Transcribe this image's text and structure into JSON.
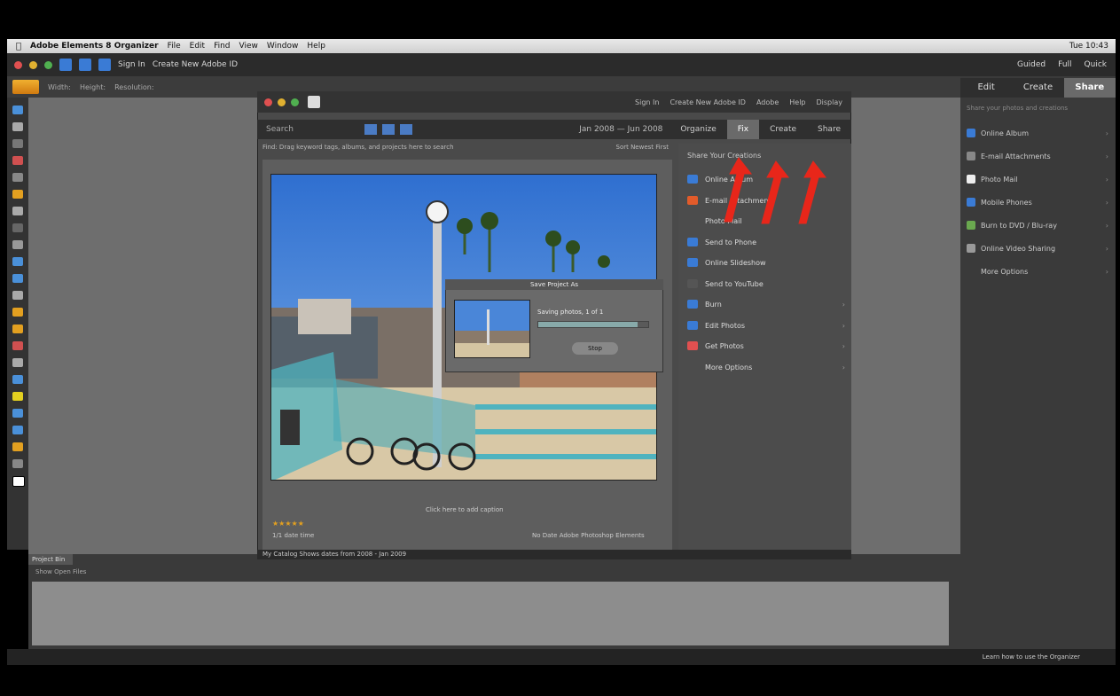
{
  "menubar": {
    "apple": "",
    "app": "Adobe Elements 8 Organizer",
    "items": [
      "File",
      "Edit",
      "Find",
      "View",
      "Window",
      "Help"
    ],
    "clock": "Tue 10:43"
  },
  "editor_bar": {
    "signin": "Sign In",
    "create_id": "Create New Adobe ID",
    "right": [
      "Guided",
      "Full",
      "Quick"
    ]
  },
  "optbar": {
    "items": [
      "Width:",
      "Height:",
      "Resolution:"
    ]
  },
  "right_panel": {
    "tabs": [
      "Edit",
      "Create",
      "Share"
    ],
    "subtitle": "Share your photos and creations",
    "items": [
      {
        "label": "Online Album",
        "color": "#3a7bd5"
      },
      {
        "label": "E-mail Attachments",
        "color": "#888"
      },
      {
        "label": "Photo Mail",
        "color": "#eee"
      },
      {
        "label": "Mobile Phones",
        "color": "#3a7bd5"
      },
      {
        "label": "Burn to DVD / Blu-ray",
        "color": "#6aa84f"
      },
      {
        "label": "Online Video Sharing",
        "color": "#999"
      },
      {
        "label": "More Options",
        "color": "#3a3a3a"
      }
    ]
  },
  "organizer": {
    "topbar": [
      "Sign In",
      "Create New Adobe ID",
      "Adobe",
      "Help",
      "Display"
    ],
    "search": "Search",
    "date_range": "Jan 2008 — Jun 2008",
    "tabs": [
      "Organize",
      "Fix",
      "Create",
      "Share"
    ],
    "media_header": "Find: Drag keyword tags, albums, and projects here to search",
    "sort": "Sort Newest First",
    "caption": "Click here to add caption",
    "rating": "★★★★★",
    "foot_left": "1/1 date time",
    "foot_right": "No Date  Adobe Photoshop Elements",
    "status": "My Catalog    Shows dates from 2008 - Jan 2009"
  },
  "share_panel": {
    "header": "Share Your Creations",
    "items": [
      {
        "label": "Online Album",
        "color": "#3a7bd5",
        "chev": false
      },
      {
        "label": "E-mail Attachments",
        "color": "#e25b2a",
        "chev": false
      },
      {
        "label": "Photo Mail",
        "color": "#4c4c4c",
        "chev": false
      },
      {
        "label": "Send to Phone",
        "color": "#3a7bd5",
        "chev": false
      },
      {
        "label": "Online Slideshow",
        "color": "#3a7bd5",
        "chev": false
      },
      {
        "label": "Send to YouTube",
        "color": "#555",
        "chev": false
      },
      {
        "label": "Burn",
        "color": "#3a7bd5",
        "chev": true
      },
      {
        "label": "Edit Photos",
        "color": "#3a7bd5",
        "chev": true
      },
      {
        "label": "Get Photos",
        "color": "#e05050",
        "chev": true
      },
      {
        "label": "More Options",
        "color": "#4c4c4c",
        "chev": true
      }
    ]
  },
  "dialog": {
    "title": "Save Project As",
    "text": "Saving photos, 1 of 1",
    "button": "Stop",
    "progress": 0.9
  },
  "project_bin": {
    "tab": "Project Bin",
    "show": "Show Open Files"
  },
  "statusbar": {
    "text": "Learn how to use the Organizer"
  }
}
